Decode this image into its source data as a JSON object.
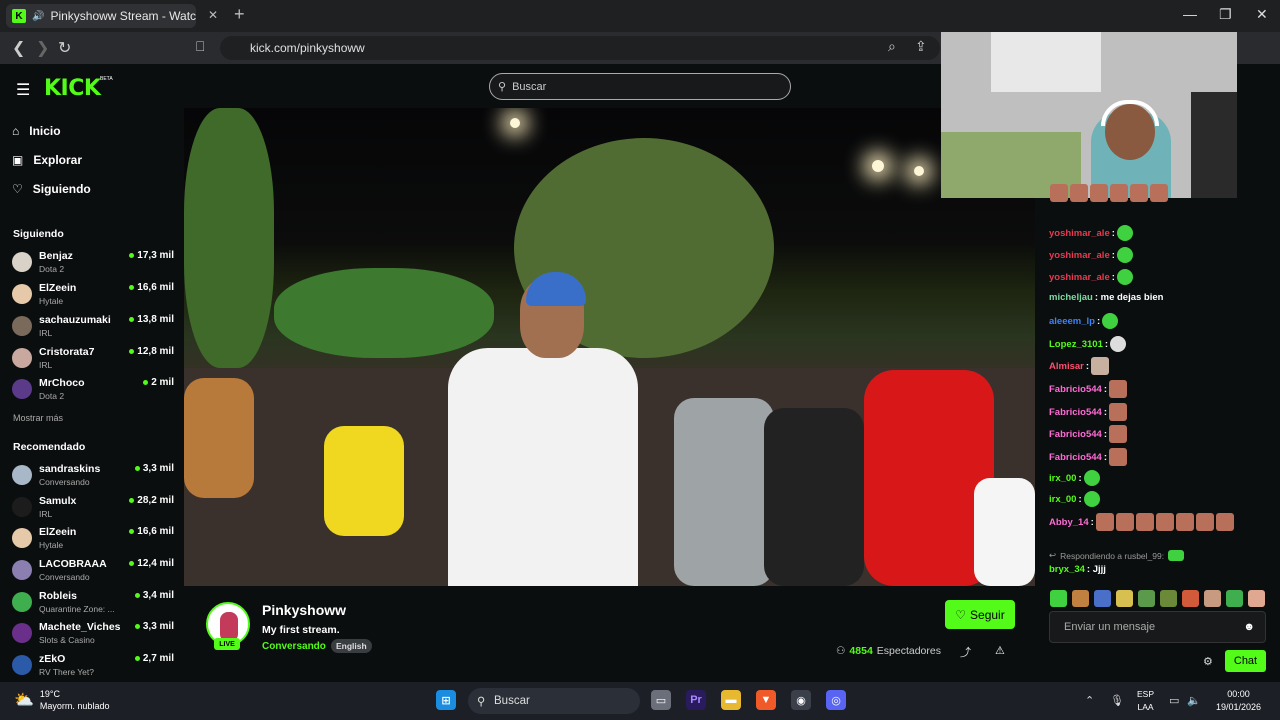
{
  "browser": {
    "tab_title": "Pinkyshoww Stream - Watch Li",
    "url": "kick.com/pinkyshoww"
  },
  "site": {
    "logo": "KICK",
    "beta": "BETA",
    "search_placeholder": "Buscar"
  },
  "nav": {
    "home": "Inicio",
    "explore": "Explorar",
    "following": "Siguiendo"
  },
  "following_section": {
    "title": "Siguiendo",
    "channels": [
      {
        "name": "Benjaz",
        "game": "Dota 2",
        "viewers": "17,3 mil"
      },
      {
        "name": "ElZeein",
        "game": "Hytale",
        "viewers": "16,6 mil"
      },
      {
        "name": "sachauzumaki",
        "game": "IRL",
        "viewers": "13,8 mil"
      },
      {
        "name": "Cristorata7",
        "game": "IRL",
        "viewers": "12,8 mil"
      },
      {
        "name": "MrChoco",
        "game": "Dota 2",
        "viewers": "2 mil"
      }
    ],
    "show_more": "Mostrar más"
  },
  "recommended_section": {
    "title": "Recomendado",
    "channels": [
      {
        "name": "sandraskins",
        "game": "Conversando",
        "viewers": "3,3 mil"
      },
      {
        "name": "Samulx",
        "game": "IRL",
        "viewers": "28,2 mil"
      },
      {
        "name": "ElZeein",
        "game": "Hytale",
        "viewers": "16,6 mil"
      },
      {
        "name": "LACOBRAAA",
        "game": "Conversando",
        "viewers": "12,4 mil"
      },
      {
        "name": "Robleis",
        "game": "Quarantine Zone: ...",
        "viewers": "3,4 mil"
      },
      {
        "name": "Machete_Viches",
        "game": "Slots & Casino",
        "viewers": "3,3 mil"
      },
      {
        "name": "zEkO",
        "game": "RV There Yet?",
        "viewers": "2,7 mil"
      }
    ]
  },
  "stream": {
    "streamer": "Pinkyshoww",
    "title": "My first stream.",
    "category": "Conversando",
    "language": "English",
    "live": "LIVE",
    "follow": "Seguir",
    "viewers": "4854",
    "viewers_label": "Espectadores"
  },
  "chat": {
    "messages": [
      {
        "user": "yoshimar_ale",
        "text": ":",
        "color": "#e8394f"
      },
      {
        "user": "yoshimar_ale",
        "text": ":",
        "color": "#e8394f"
      },
      {
        "user": "yoshimar_ale",
        "text": ":",
        "color": "#e8394f"
      },
      {
        "user": "micheljau",
        "text": ": me dejas bien",
        "color": "#7cd9a0"
      },
      {
        "user": "aleeem_lp",
        "text": ":",
        "color": "#3b82f6"
      },
      {
        "user": "Lopez_3101",
        "text": ":",
        "color": "#53fc18"
      },
      {
        "user": "Almisar",
        "text": ":",
        "color": "#ff4d6d"
      },
      {
        "user": "Fabricio544",
        "text": ":",
        "color": "#ff6bd5"
      },
      {
        "user": "Fabricio544",
        "text": ":",
        "color": "#ff6bd5"
      },
      {
        "user": "Fabricio544",
        "text": ":",
        "color": "#ff6bd5"
      },
      {
        "user": "Fabricio544",
        "text": ":",
        "color": "#ff6bd5"
      },
      {
        "user": "irx_00",
        "text": ":",
        "color": "#53fc18"
      },
      {
        "user": "irx_00",
        "text": ":",
        "color": "#53fc18"
      },
      {
        "user": "Abby_14",
        "text": ":",
        "color": "#ff6bd5"
      },
      {
        "user": "bryx_34",
        "text": ": Jjjj",
        "color": "#53fc18"
      }
    ],
    "reply_to": "Respondiendo a rusbel_99:",
    "input_placeholder": "Enviar un mensaje",
    "send": "Chat"
  },
  "taskbar": {
    "temp": "19°C",
    "weather": "Mayorm. nublado",
    "search": "Buscar",
    "lang_top": "ESP",
    "lang_bottom": "LAA",
    "time": "00:00",
    "date": "19/01/2026"
  }
}
